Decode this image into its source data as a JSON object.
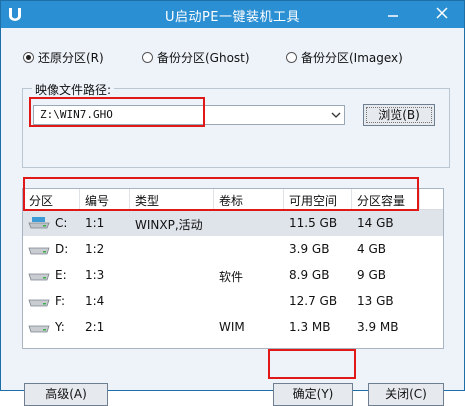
{
  "window": {
    "title": "U启动PE一键装机工具"
  },
  "mode_options": [
    {
      "label": "还原分区(R)",
      "selected": true
    },
    {
      "label": "备份分区(Ghost)",
      "selected": false
    },
    {
      "label": "备份分区(Imagex)",
      "selected": false
    }
  ],
  "image_path": {
    "label": "映像文件路径:",
    "value": "Z:\\WIN7.GHO",
    "browse_label": "浏览(B)"
  },
  "table": {
    "headers": [
      "分区",
      "编号",
      "类型",
      "卷标",
      "可用空间",
      "分区容量"
    ],
    "rows": [
      {
        "partition": "C:",
        "number": "1:1",
        "type": "WINXP,活动",
        "label": "",
        "free": "11.5 GB",
        "capacity": "14 GB",
        "selected": true
      },
      {
        "partition": "D:",
        "number": "1:2",
        "type": "",
        "label": "",
        "free": "3.9 GB",
        "capacity": "4 GB",
        "selected": false
      },
      {
        "partition": "E:",
        "number": "1:3",
        "type": "",
        "label": "软件",
        "free": "8.9 GB",
        "capacity": "9 GB",
        "selected": false
      },
      {
        "partition": "F:",
        "number": "1:4",
        "type": "",
        "label": "",
        "free": "12.7 GB",
        "capacity": "13 GB",
        "selected": false
      },
      {
        "partition": "Y:",
        "number": "2:1",
        "type": "",
        "label": "WIM",
        "free": "1.3 MB",
        "capacity": "3.9 MB",
        "selected": false
      }
    ]
  },
  "buttons": {
    "advanced": "高级(A)",
    "ok": "确定(Y)",
    "close": "关闭(C)"
  },
  "colors": {
    "titlebar": "#2b8fd3",
    "highlight": "#e01818",
    "selected_row": "#dfe4ea"
  },
  "icons": [
    "app-icon",
    "minimize-icon",
    "close-icon",
    "dropdown-arrow-icon",
    "drive-icon",
    "system-drive-icon"
  ]
}
